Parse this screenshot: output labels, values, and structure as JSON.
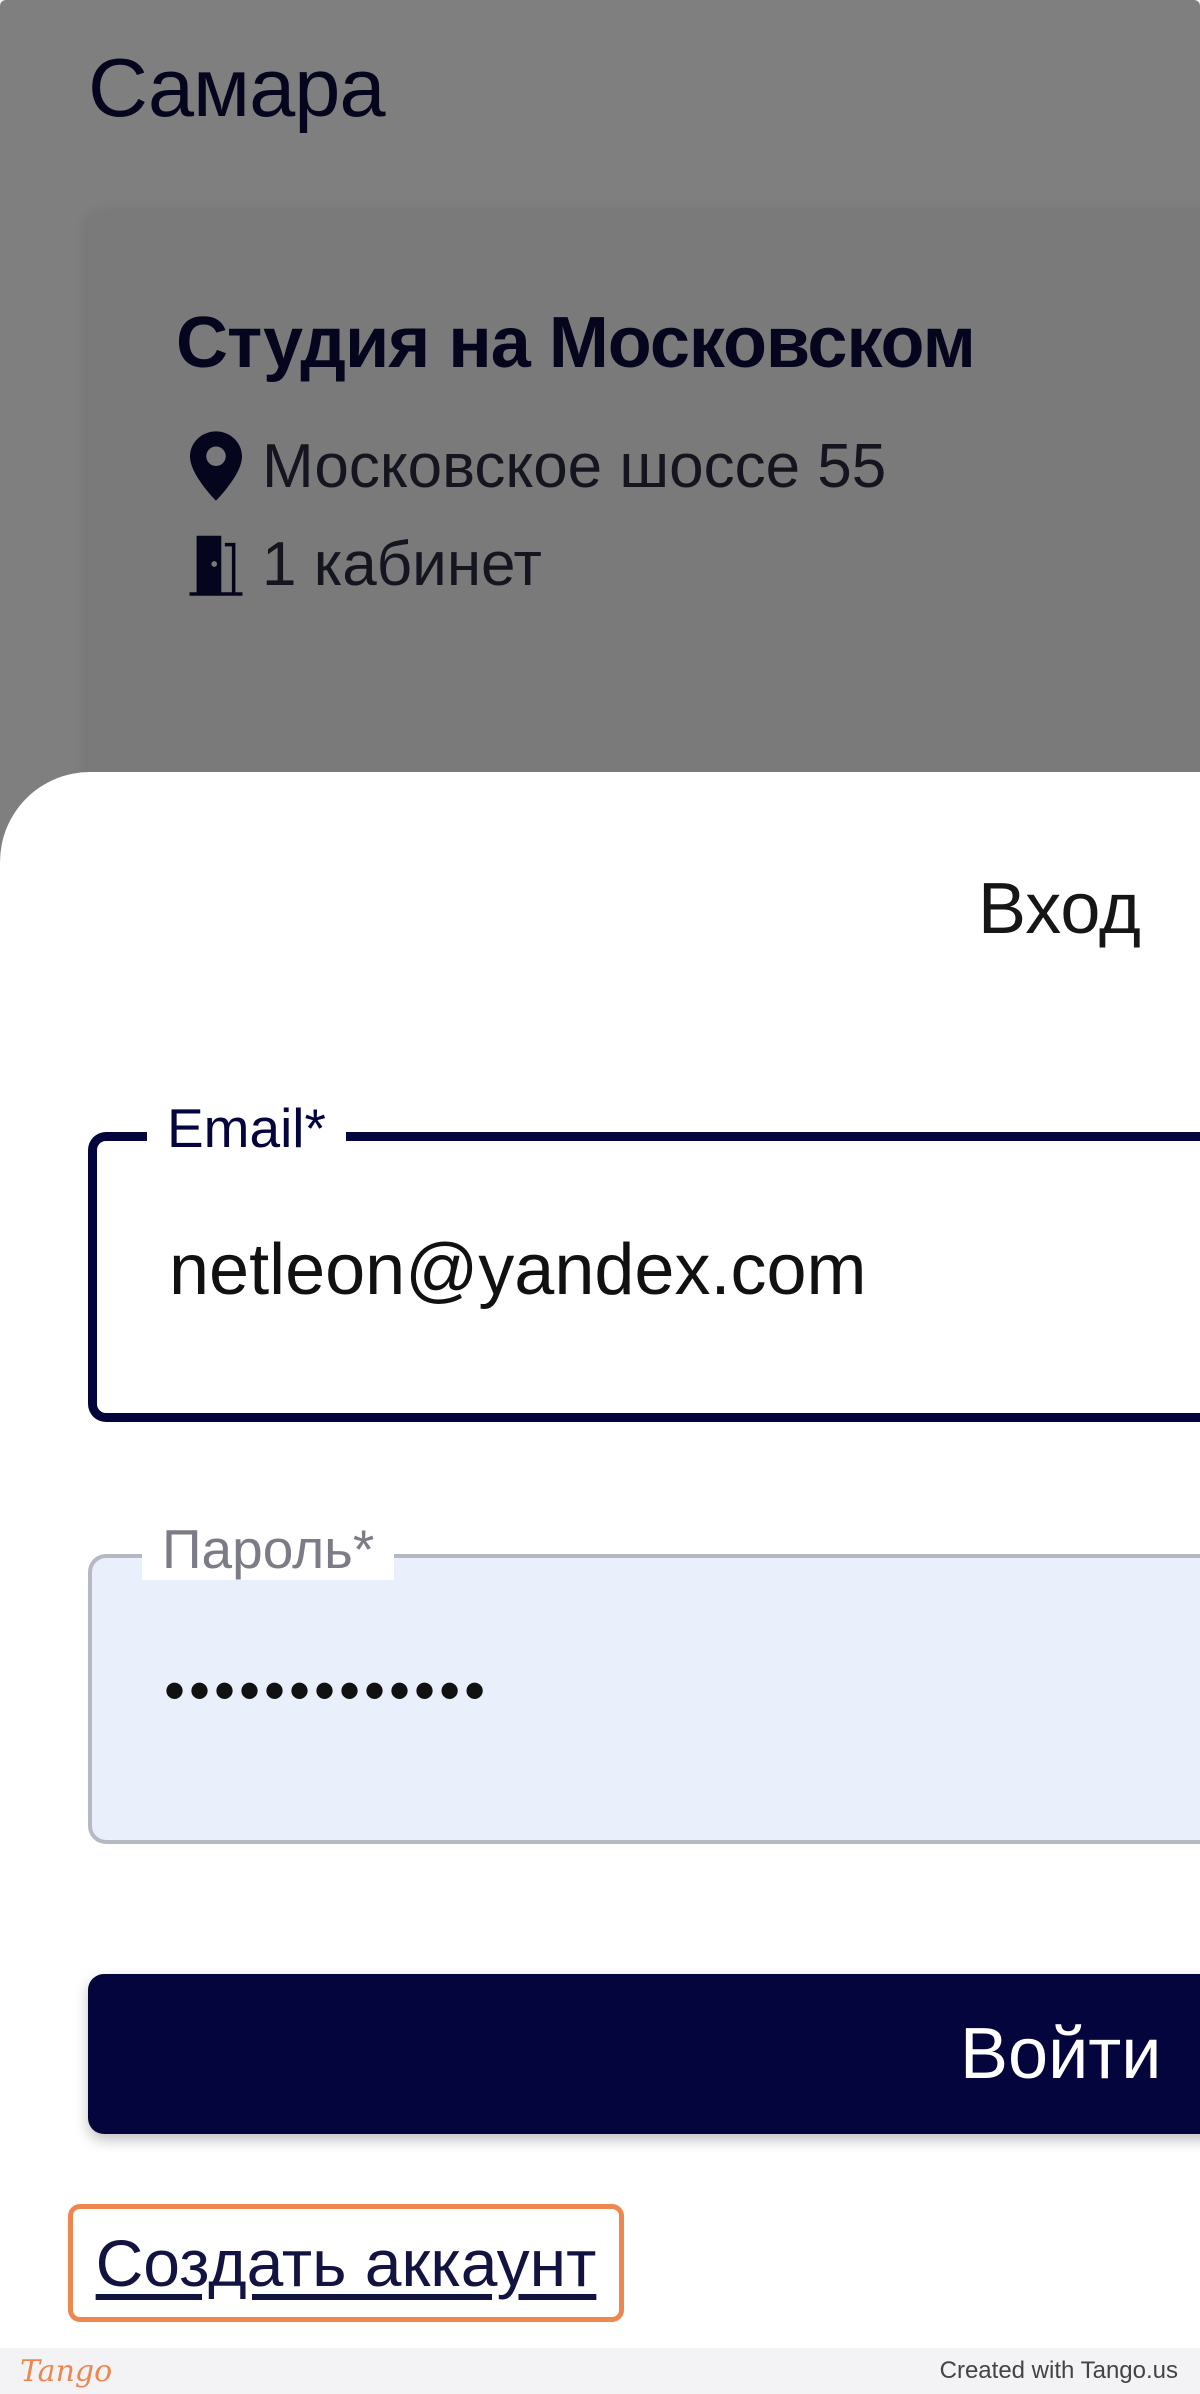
{
  "background_page": {
    "city_title": "Самара",
    "studio_card": {
      "name": "Студия на Московском",
      "address": "Московское шоссе 55",
      "address_icon": "map-pin-icon",
      "rooms": "1 кабинет",
      "rooms_icon": "door-icon"
    }
  },
  "login_sheet": {
    "title": "Вход",
    "email": {
      "label": "Email*",
      "value": "netleon@yandex.com"
    },
    "password": {
      "label": "Пароль*",
      "value": "•••••••••••••"
    },
    "submit_label": "Войти",
    "create_account_label": "Создать аккаунт",
    "highlight_color": "#ee8650",
    "accent_color": "#05053d"
  },
  "footer": {
    "logo": "Tango",
    "text": "Created with Tango.us"
  }
}
